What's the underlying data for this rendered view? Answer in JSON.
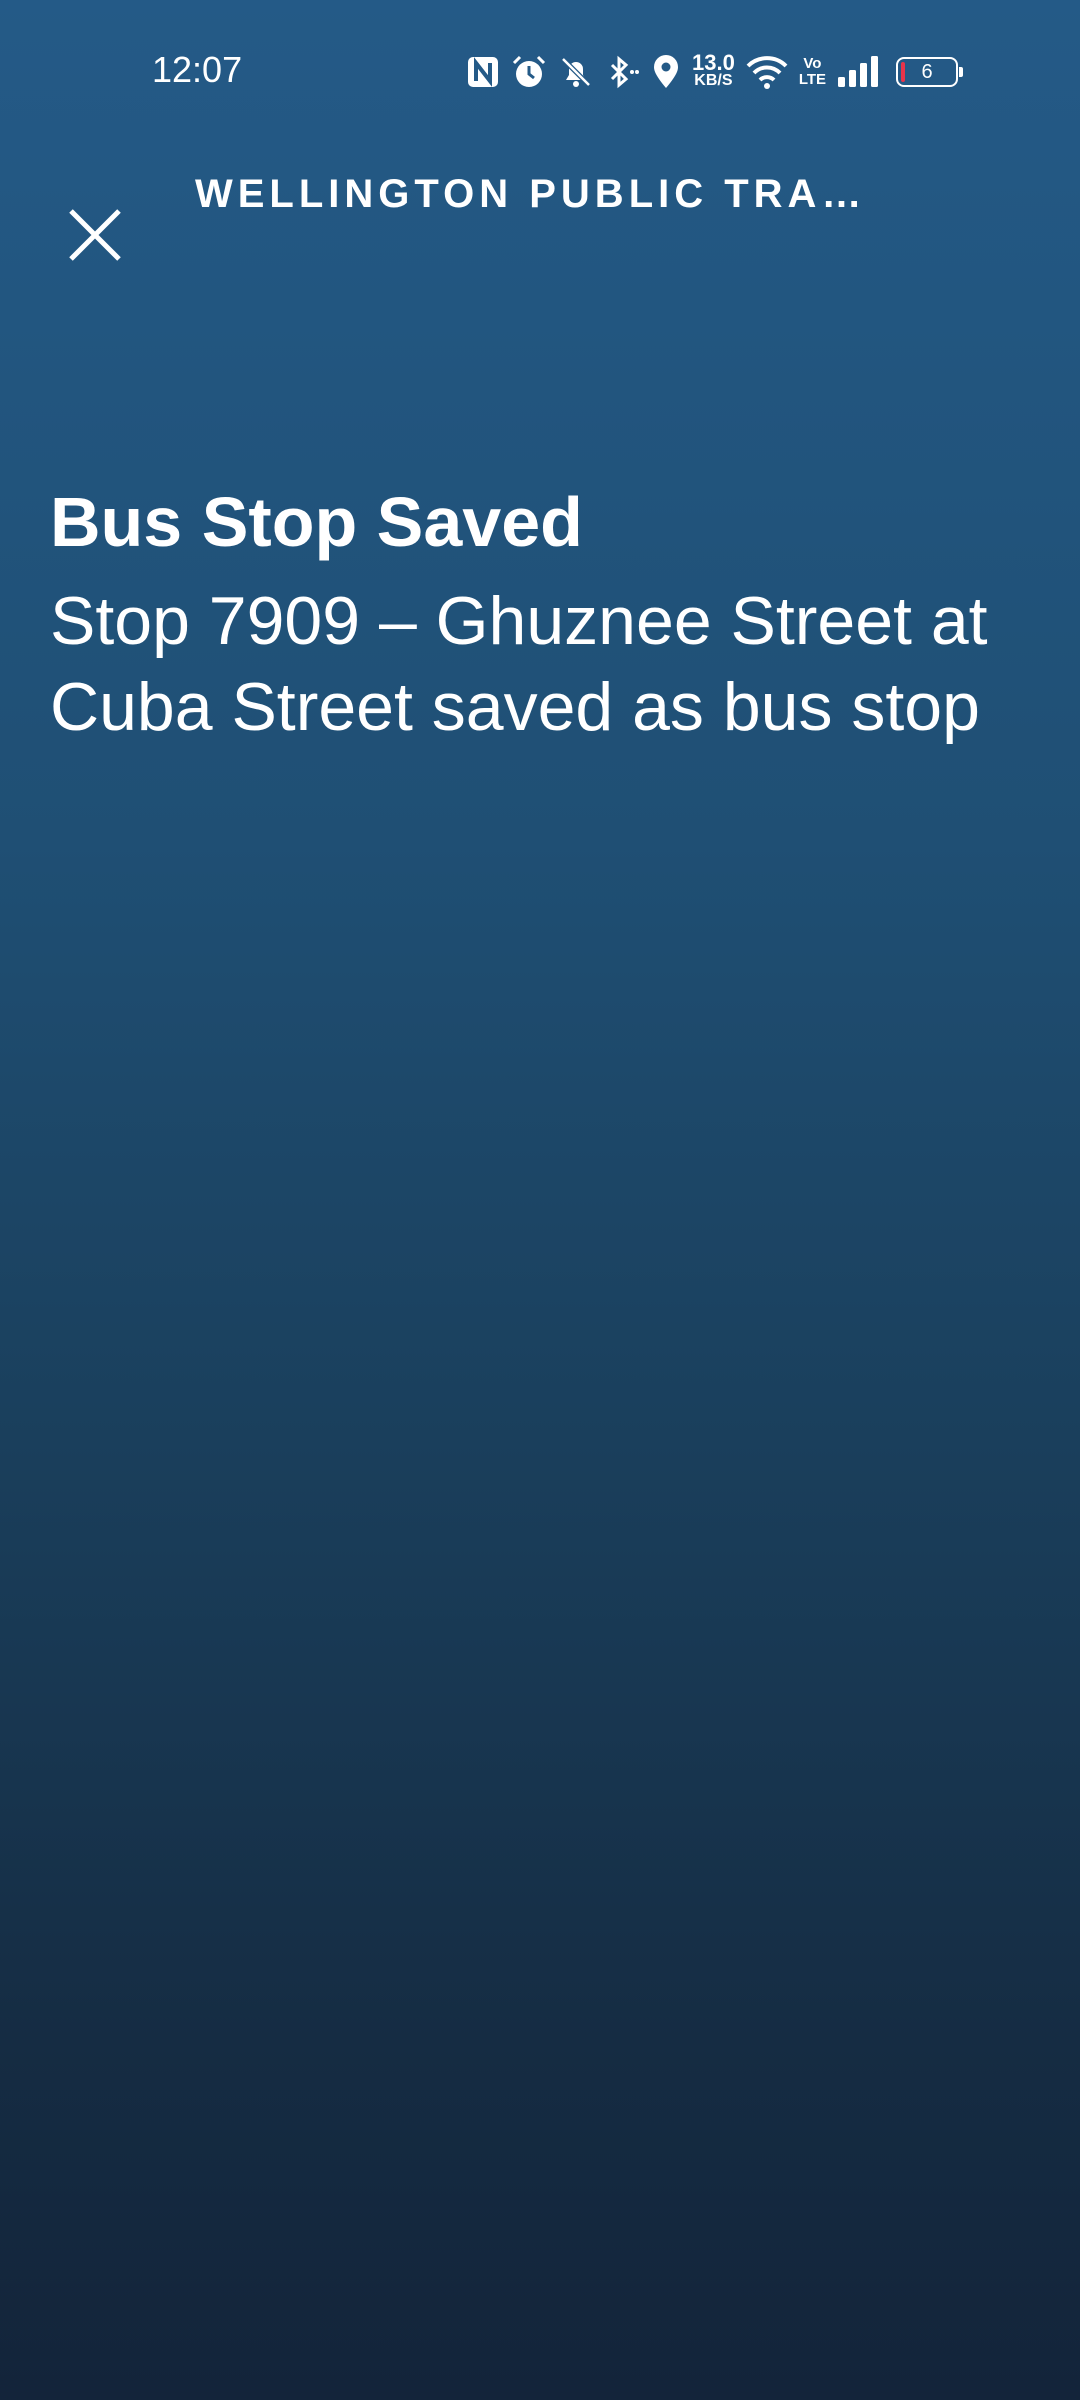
{
  "status_bar": {
    "time": "12:07",
    "icons": [
      "nfc-icon",
      "alarm-icon",
      "mute-icon",
      "bluetooth-icon",
      "location-icon",
      "wifi-icon",
      "signal-icon"
    ],
    "net_speed_value": "13.0",
    "net_speed_unit": "KB/S",
    "volte_top": "Vo",
    "volte_bottom": "LTE",
    "battery_level": "6",
    "battery_fill_color": "#e8344a"
  },
  "header": {
    "title": "WELLINGTON PUBLIC TRAN...",
    "close_icon": "close-icon"
  },
  "content": {
    "title": "Bus Stop Saved",
    "message": "Stop 7909 – Ghuznee Street at Cuba Street saved as bus stop"
  },
  "colors": {
    "background_top": "#245a87",
    "background_bottom": "#13243a",
    "text": "#ffffff"
  }
}
